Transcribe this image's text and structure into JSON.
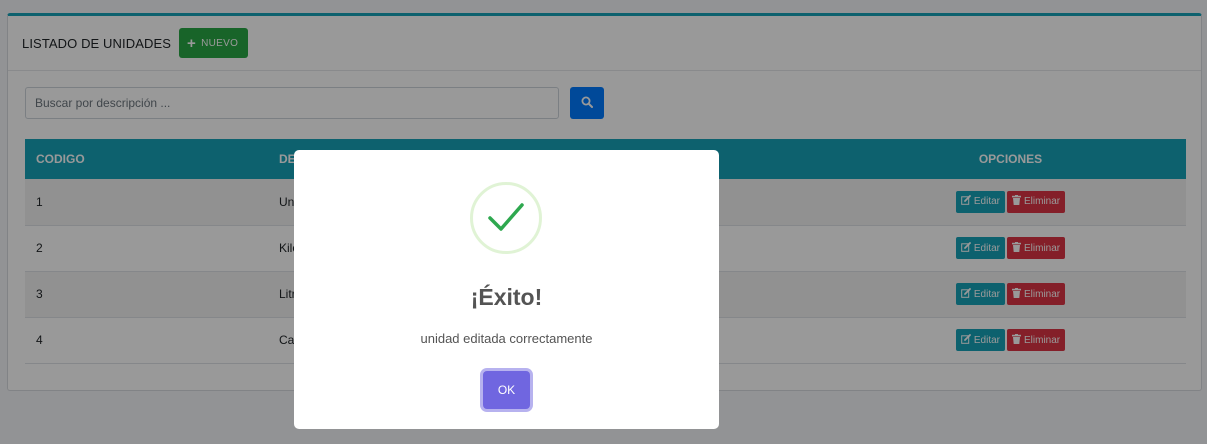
{
  "header": {
    "title": "LISTADO DE UNIDADES",
    "new_button_label": "NUEVO"
  },
  "search": {
    "placeholder": "Buscar por descripción ..."
  },
  "table": {
    "columns": [
      "CODIGO",
      "DESCRIPCION",
      "OPCIONES"
    ],
    "rows": [
      {
        "codigo": "1",
        "descripcion": "Unidad"
      },
      {
        "codigo": "2",
        "descripcion": "Kilogramo"
      },
      {
        "codigo": "3",
        "descripcion": "Litro"
      },
      {
        "codigo": "4",
        "descripcion": "Caja"
      }
    ],
    "edit_label": "Editar",
    "delete_label": "Eliminar"
  },
  "modal": {
    "title": "¡Éxito!",
    "message": "unidad editada correctamente",
    "ok_label": "OK"
  },
  "icons": {
    "new": "plus-icon",
    "search": "search-icon",
    "edit": "edit-icon",
    "delete": "trash-icon",
    "success": "success-check-icon"
  },
  "colors": {
    "primary": "#007bff",
    "success": "#28a745",
    "info": "#17a2b8",
    "danger": "#dc3545",
    "modal_button": "#7066e0",
    "check": "#2ea84f"
  }
}
